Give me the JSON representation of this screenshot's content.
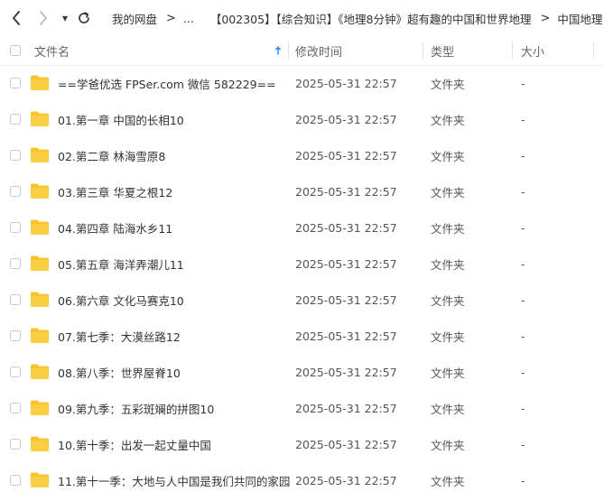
{
  "nav": {
    "more_label": "▾"
  },
  "breadcrumb": [
    {
      "label": "我的网盘"
    },
    {
      "label": "..."
    },
    {
      "label": "【002305】【综合知识】《地理8分钟》超有趣的中国和世界地理"
    },
    {
      "label": "中国地理 视频"
    }
  ],
  "columns": {
    "name": "文件名",
    "modified": "修改时间",
    "type": "类型",
    "size": "大小",
    "sort_icon": "arrow-up-icon"
  },
  "files": [
    {
      "name": "==学爸优选 FPSer.com 微信 582229==",
      "modified": "2025-05-31 22:57",
      "type": "文件夹",
      "size": "-"
    },
    {
      "name": "01.第一章 中国的长相10",
      "modified": "2025-05-31 22:57",
      "type": "文件夹",
      "size": "-"
    },
    {
      "name": "02.第二章 林海雪原8",
      "modified": "2025-05-31 22:57",
      "type": "文件夹",
      "size": "-"
    },
    {
      "name": "03.第三章 华夏之根12",
      "modified": "2025-05-31 22:57",
      "type": "文件夹",
      "size": "-"
    },
    {
      "name": "04.第四章 陆海水乡11",
      "modified": "2025-05-31 22:57",
      "type": "文件夹",
      "size": "-"
    },
    {
      "name": "05.第五章 海洋弄潮儿11",
      "modified": "2025-05-31 22:57",
      "type": "文件夹",
      "size": "-"
    },
    {
      "name": "06.第六章 文化马赛克10",
      "modified": "2025-05-31 22:57",
      "type": "文件夹",
      "size": "-"
    },
    {
      "name": "07.第七季：大漠丝路12",
      "modified": "2025-05-31 22:57",
      "type": "文件夹",
      "size": "-"
    },
    {
      "name": "08.第八季：世界屋脊10",
      "modified": "2025-05-31 22:57",
      "type": "文件夹",
      "size": "-"
    },
    {
      "name": "09.第九季：五彩斑斓的拼图10",
      "modified": "2025-05-31 22:57",
      "type": "文件夹",
      "size": "-"
    },
    {
      "name": "10.第十季：出发一起丈量中国",
      "modified": "2025-05-31 22:57",
      "type": "文件夹",
      "size": "-"
    },
    {
      "name": "11.第十一季：大地与人中国是我们共同的家园",
      "modified": "2025-05-31 22:57",
      "type": "文件夹",
      "size": "-"
    }
  ],
  "colors": {
    "folder": "#f8c430",
    "sort_arrow": "#3b8ff6"
  }
}
